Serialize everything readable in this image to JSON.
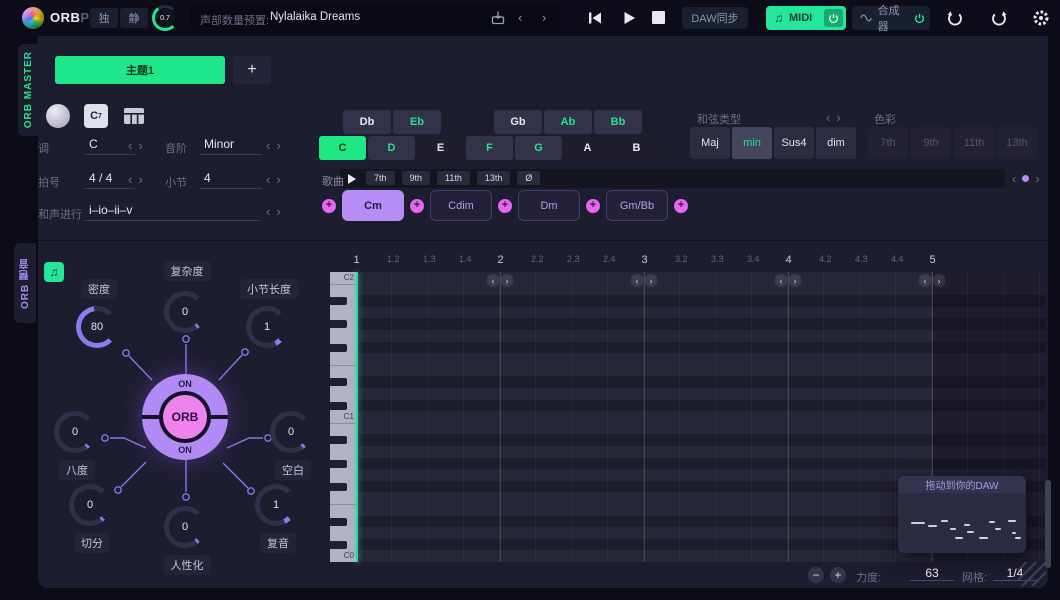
{
  "colors": {
    "green": "#24e795",
    "purple": "#b18af5",
    "pink": "#e566ef"
  },
  "topbar": {
    "brand": "ORB",
    "brand_suffix": "PS",
    "solo": "独",
    "mute": "静",
    "volume": "0.7",
    "preset_label": "声部数量预置:",
    "preset_value": "Nylalaika Dreams",
    "daw_sync": "DAW同步",
    "midi_label": "MIDI",
    "synth_label": "合成器"
  },
  "sidebar": {
    "master_tab": "ORB MASTER",
    "module_tab": "ORB 琶音"
  },
  "theme": {
    "tab": "主题1",
    "add": "+"
  },
  "params": {
    "key_label": "调",
    "key_value": "C",
    "scale_label": "音阶",
    "scale_value": "Minor",
    "timesig_label": "拍号",
    "timesig_value": "4 / 4",
    "bars_label": "小节",
    "bars_value": "4",
    "progression_label": "和声进行",
    "progression_value": "i–io–ii–v"
  },
  "note_selector": {
    "black_keys": [
      {
        "label": "Db",
        "state": "black-plain"
      },
      {
        "label": "Eb",
        "state": "inscale"
      },
      {
        "label": "Gb",
        "state": "black-plain"
      },
      {
        "label": "Ab",
        "state": "inscale"
      },
      {
        "label": "Bb",
        "state": "inscale"
      }
    ],
    "white_keys": [
      {
        "label": "C",
        "state": "root"
      },
      {
        "label": "D",
        "state": "inscale"
      },
      {
        "label": "E",
        "state": "plain"
      },
      {
        "label": "F",
        "state": "inscale"
      },
      {
        "label": "G",
        "state": "inscale"
      },
      {
        "label": "A",
        "state": "plain"
      },
      {
        "label": "B",
        "state": "plain"
      }
    ]
  },
  "chord_type": {
    "label": "和弦类型",
    "options": [
      {
        "label": "Maj",
        "selected": false
      },
      {
        "label": "min",
        "selected": true
      },
      {
        "label": "Sus4",
        "selected": false
      },
      {
        "label": "dim",
        "selected": false
      }
    ]
  },
  "color_section": {
    "label": "色彩",
    "options": [
      "7th",
      "9th",
      "11th",
      "13th"
    ]
  },
  "song_row": {
    "label": "歌曲",
    "extensions": [
      "7th",
      "9th",
      "11th",
      "13th",
      "Ø"
    ]
  },
  "progression_chords": [
    {
      "label": "Cm",
      "selected": true
    },
    {
      "label": "Cdim",
      "selected": false
    },
    {
      "label": "Dm",
      "selected": false
    },
    {
      "label": "Gm/Bb",
      "selected": false
    }
  ],
  "orb_panel": {
    "center_label": "ORB",
    "on_top": "ON",
    "on_bottom": "ON",
    "knobs": [
      {
        "label": "密度",
        "value": "80"
      },
      {
        "label": "复杂度",
        "value": "0"
      },
      {
        "label": "小节长度",
        "value": "1"
      },
      {
        "label": "八度",
        "value": "0"
      },
      {
        "label": "空白",
        "value": "0"
      },
      {
        "label": "切分",
        "value": "0"
      },
      {
        "label": "人性化",
        "value": "0"
      },
      {
        "label": "复音",
        "value": "1"
      }
    ]
  },
  "pianoroll": {
    "ticks": [
      "1",
      "1.2",
      "1.3",
      "1.4",
      "2",
      "2.2",
      "2.3",
      "2.4",
      "3",
      "3.2",
      "3.3",
      "3.4",
      "4",
      "4.2",
      "4.3",
      "4.4",
      "5"
    ],
    "octave_labels": [
      "C2",
      "C1",
      "C0"
    ],
    "drag_hint": "拖动到你的DAW",
    "velocity_label": "力度:",
    "velocity_value": "63",
    "grid_label": "网格:",
    "grid_value": "1/4"
  }
}
